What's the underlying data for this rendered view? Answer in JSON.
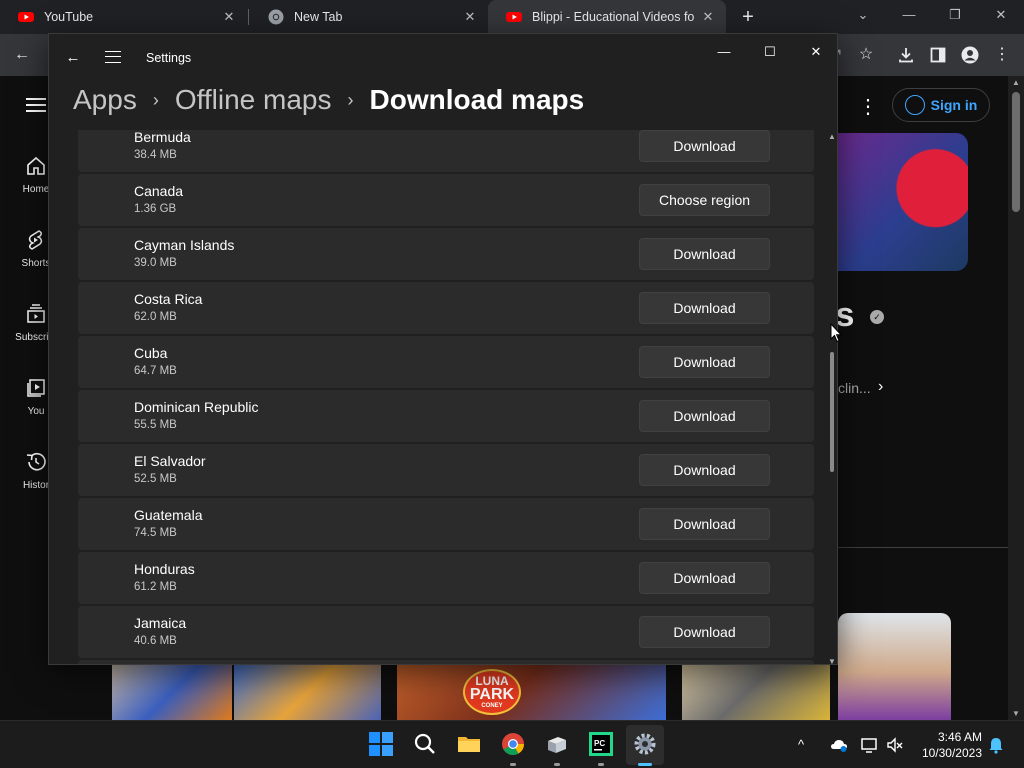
{
  "browser": {
    "tabs": [
      {
        "title": "YouTube",
        "icon": "youtube-icon"
      },
      {
        "title": "New Tab",
        "icon": "chrome-icon"
      },
      {
        "title": "Blippi - Educational Videos for K",
        "icon": "youtube-icon"
      }
    ]
  },
  "youtube": {
    "sidebar": [
      "Home",
      "Shorts",
      "Subscript",
      "You",
      "Histor"
    ],
    "sign_in_label": "Sign in",
    "channel_name_fragment": "ls",
    "channel_desc_fragment": "clin..."
  },
  "settings": {
    "window_title": "Settings",
    "breadcrumb": {
      "level1": "Apps",
      "level2": "Offline maps",
      "current": "Download maps"
    },
    "maps": [
      {
        "name": "Bermuda",
        "size": "38.4 MB",
        "action": "Download"
      },
      {
        "name": "Canada",
        "size": "1.36 GB",
        "action": "Choose region"
      },
      {
        "name": "Cayman Islands",
        "size": "39.0 MB",
        "action": "Download"
      },
      {
        "name": "Costa Rica",
        "size": "62.0 MB",
        "action": "Download"
      },
      {
        "name": "Cuba",
        "size": "64.7 MB",
        "action": "Download"
      },
      {
        "name": "Dominican Republic",
        "size": "55.5 MB",
        "action": "Download"
      },
      {
        "name": "El Salvador",
        "size": "52.5 MB",
        "action": "Download"
      },
      {
        "name": "Guatemala",
        "size": "74.5 MB",
        "action": "Download"
      },
      {
        "name": "Honduras",
        "size": "61.2 MB",
        "action": "Download"
      },
      {
        "name": "Jamaica",
        "size": "40.6 MB",
        "action": "Download"
      }
    ]
  },
  "thumbnail_text": {
    "line1": "LUNA",
    "line2": "PARK",
    "line3": "CONEY"
  },
  "taskbar": {
    "time": "3:46 AM",
    "date": "10/30/2023"
  },
  "colors": {
    "accent": "#3ea6ff",
    "youtube_red": "#ff0000",
    "windows_blue": "#0a84ff"
  }
}
